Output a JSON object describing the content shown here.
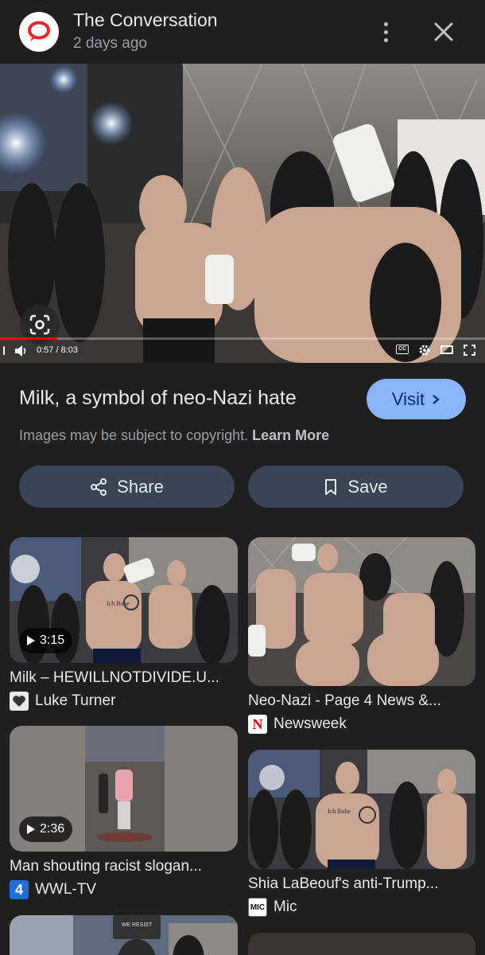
{
  "header": {
    "source_name": "The Conversation",
    "time_ago": "2 days ago",
    "brand_color": "#e8242a"
  },
  "video": {
    "time_display": "0:57 / 8:03",
    "progress_fraction": 0.118,
    "cc_label": "CC"
  },
  "result": {
    "title": "Milk, a symbol of neo-Nazi hate",
    "visit_label": "Visit",
    "copyright_text": "Images may be subject to copyright.",
    "learn_more": "Learn More",
    "share_label": "Share",
    "save_label": "Save"
  },
  "related": [
    {
      "title": "Milk – HEWILLNOTDIVIDE.U...",
      "source": "Luke Turner",
      "duration": "3:15",
      "tattoo": "Ich Rohe"
    },
    {
      "title": "Neo-Nazi - Page 4 News &...",
      "source": "Newsweek",
      "source_letter": "N"
    },
    {
      "title": "Man shouting racist slogan...",
      "source": "WWL-TV",
      "duration": "2:36",
      "source_letter": "4"
    },
    {
      "title": "Shia LaBeouf's anti-Trump...",
      "source": "Mic",
      "source_letter": "MIC",
      "tattoo": "Ich Rohe"
    },
    {
      "sign": "WE RESIST"
    }
  ],
  "colors": {
    "accent": "#8ab4f8",
    "button_bg": "#394457",
    "background": "#1f1f1f",
    "progress": "#ff0000"
  }
}
